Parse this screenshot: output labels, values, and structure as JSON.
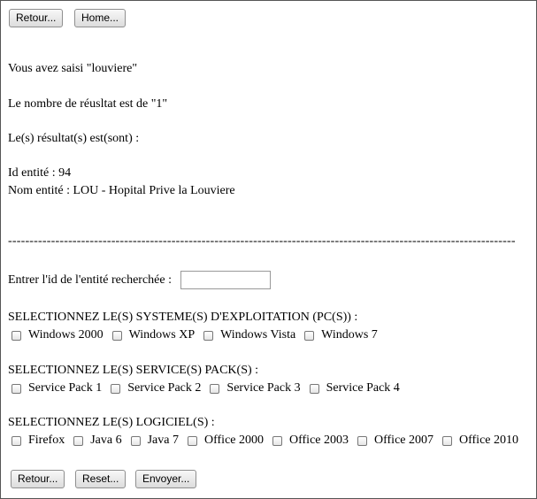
{
  "top_buttons": {
    "back": "Retour...",
    "home": "Home..."
  },
  "result": {
    "entered": "Vous avez saisi \"louviere\"",
    "count": "Le nombre de réusltat est de \"1\"",
    "results_label": "Le(s) résultat(s) est(sont) :",
    "entity_id": "Id entité : 94",
    "entity_name": "Nom entité : LOU - Hopital Prive la Louviere"
  },
  "separator": "----------------------------------------------------------------------------------------------------------------------",
  "form": {
    "entity_id_label": "Entrer l'id de l'entité recherchée :",
    "entity_id_value": "",
    "os_label": "SELECTIONNEZ LE(S) SYSTEME(S) D'EXPLOITATION (PC(S)) :",
    "os_options": [
      "Windows 2000",
      "Windows XP",
      "Windows Vista",
      "Windows 7"
    ],
    "sp_label": "SELECTIONNEZ LE(S) SERVICE(S) PACK(S) :",
    "sp_options": [
      "Service Pack 1",
      "Service Pack 2",
      "Service Pack 3",
      "Service Pack 4"
    ],
    "sw_label": "SELECTIONNEZ LE(S) LOGICIEL(S) :",
    "sw_options": [
      "Firefox",
      "Java 6",
      "Java 7",
      "Office 2000",
      "Office 2003",
      "Office 2007",
      "Office 2010"
    ]
  },
  "bottom_buttons": {
    "back": "Retour...",
    "reset": "Reset...",
    "send": "Envoyer..."
  }
}
